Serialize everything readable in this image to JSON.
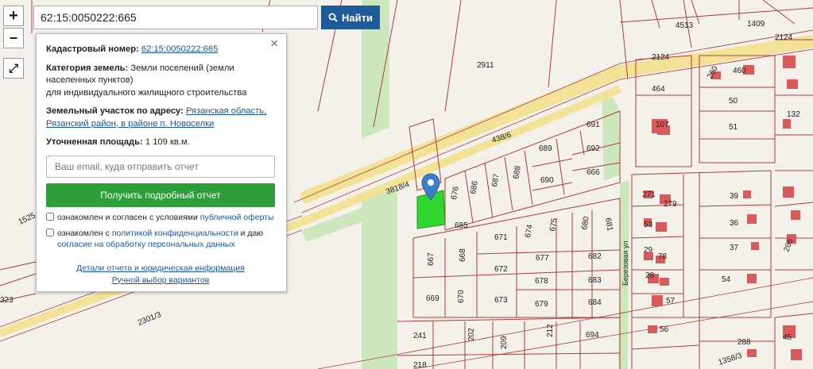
{
  "zoom": {
    "in": "+",
    "out": "−",
    "fullscreen": "⤢"
  },
  "search": {
    "value": "62:15:0050222:665",
    "button": "Найти"
  },
  "popup": {
    "close": "×",
    "cad_label": "Кадастровый номер:",
    "cad_value": "62:15:0050222:665",
    "cat_label": "Категория земель:",
    "cat_value": "Земли поселений (земли населенных пунктов)",
    "use_value": "для индивидуального жилищного строительства",
    "addr_label": "Земельный участок по адресу:",
    "addr_value": "Рязанская область, Рязанский район, в районе п. Новоселки",
    "area_label": "Уточненная площадь:",
    "area_value": "1 109 кв.м.",
    "email_placeholder": "Ваш email, куда отправить отчет",
    "report_button": "Получить подробный отчет",
    "terms_text": "ознакомлен и согласен с условиями",
    "terms_link": "публичной оферты",
    "privacy_text": "ознакомлен с",
    "privacy_link": "политикой конфиденциальности",
    "privacy_and": "и даю",
    "consent_link": "согласие на обработку персональных данных",
    "details_link": "Детали отчета и юридическая информация",
    "manual_link": "Ручной выбор вариантов"
  },
  "map": {
    "colors": {
      "background": "#f4f1ea",
      "road": "#f3e9a8",
      "greenery": "#c9e6b8",
      "parcel_line": "#b23a3a",
      "selected": "#2fd62f",
      "marker": "#3f7fc8",
      "building": "#d85a5a"
    },
    "labels": [
      "2911",
      "2124",
      "2124",
      "4513",
      "1409",
      "464",
      "107",
      "260",
      "460",
      "50",
      "51",
      "132",
      "438/6",
      "691",
      "692",
      "666",
      "689",
      "690",
      "686",
      "687",
      "688",
      "676",
      "3818/4",
      "685",
      "671",
      "674",
      "675",
      "680",
      "681",
      "682",
      "677",
      "683",
      "672",
      "678",
      "684",
      "673",
      "679",
      "667",
      "668",
      "669",
      "670",
      "1525",
      "1358/3",
      "241",
      "202",
      "209",
      "212",
      "694",
      "218",
      "2301/3",
      "323",
      "271",
      "279",
      "39",
      "53",
      "36",
      "29",
      "78",
      "37",
      "28",
      "54",
      "57",
      "56",
      "288",
      "45",
      "265",
      "Березовая ул"
    ]
  }
}
